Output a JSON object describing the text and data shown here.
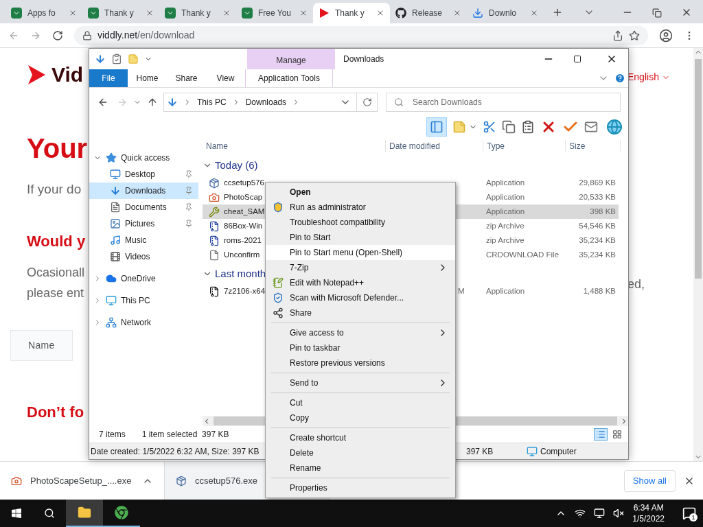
{
  "browser": {
    "tabs": [
      {
        "title": "Apps fo",
        "kind": "sheet",
        "selected": false
      },
      {
        "title": "Thank y",
        "kind": "sheet",
        "selected": false
      },
      {
        "title": "Thank y",
        "kind": "sheet",
        "selected": false
      },
      {
        "title": "Free You",
        "kind": "sheet",
        "selected": false
      },
      {
        "title": "Thank y",
        "kind": "video",
        "selected": true
      },
      {
        "title": "Release",
        "kind": "github",
        "selected": false
      },
      {
        "title": "Downlo",
        "kind": "download",
        "selected": false
      }
    ],
    "address": {
      "host": "viddly.net",
      "path": "/en/download"
    }
  },
  "page": {
    "logo": "Vid",
    "language": "English",
    "heading": "Your",
    "intro": "If your do",
    "subheading": "Would y",
    "para_lines": [
      "Ocasionall",
      "please ent"
    ],
    "para_right": "ed,",
    "name_field": "Name",
    "heading2": "Don’t fo"
  },
  "explorer": {
    "title": "Downloads",
    "context_tab": "Manage",
    "ribbon_tabs": [
      {
        "label": "File",
        "kind": "file"
      },
      {
        "label": "Home",
        "kind": "tab"
      },
      {
        "label": "Share",
        "kind": "tab"
      },
      {
        "label": "View",
        "kind": "tab"
      },
      {
        "label": "Application Tools",
        "kind": "context"
      }
    ],
    "breadcrumb": [
      "This PC",
      "Downloads"
    ],
    "search": {
      "placeholder": "Search Downloads"
    },
    "pane_toggle": {
      "on": true
    },
    "nav": [
      {
        "label": "Quick access",
        "kind": "star",
        "expanded": true,
        "selected": false,
        "children": [
          {
            "label": "Desktop",
            "kind": "desktop",
            "pinned": true,
            "selected": false
          },
          {
            "label": "Downloads",
            "kind": "download",
            "pinned": true,
            "selected": true
          },
          {
            "label": "Documents",
            "kind": "document",
            "pinned": true,
            "selected": false
          },
          {
            "label": "Pictures",
            "kind": "picture",
            "pinned": true,
            "selected": false
          },
          {
            "label": "Music",
            "kind": "music",
            "pinned": false,
            "selected": false
          },
          {
            "label": "Videos",
            "kind": "video",
            "pinned": false,
            "selected": false
          }
        ]
      },
      {
        "label": "OneDrive",
        "kind": "cloud",
        "expanded": false,
        "selected": false
      },
      {
        "label": "This PC",
        "kind": "pc",
        "expanded": false,
        "selected": false
      },
      {
        "label": "Network",
        "kind": "network",
        "expanded": false,
        "selected": false
      }
    ],
    "columns": [
      "Name",
      "Date modified",
      "Type",
      "Size"
    ],
    "groups": [
      {
        "label": "Today (6)",
        "expanded": true,
        "files": [
          {
            "name": "ccsetup576",
            "kind": "setup",
            "type": "Application",
            "size": "29,869 KB",
            "selected": false
          },
          {
            "name": "PhotoScap",
            "kind": "photoscape",
            "type": "Application",
            "size": "20,533 KB",
            "selected": false
          },
          {
            "name": "cheat_SAM",
            "kind": "cheat",
            "type": "Application",
            "size": "398 KB",
            "selected": true
          },
          {
            "name": "86Box-Win",
            "kind": "zip",
            "type": "zip Archive",
            "size": "54,546 KB",
            "selected": false
          },
          {
            "name": "roms-2021",
            "kind": "zip",
            "type": "zip Archive",
            "size": "35,234 KB",
            "selected": false
          },
          {
            "name": "Unconfirm",
            "kind": "blank",
            "type": "CRDOWNLOAD File",
            "size": "35,234 KB",
            "selected": false
          }
        ]
      },
      {
        "label": "Last month",
        "expanded": true,
        "files": [
          {
            "name": "7z2106-x64",
            "kind": "sevenzip",
            "date": "M",
            "type": "Application",
            "size": "1,488 KB",
            "selected": false
          }
        ]
      }
    ],
    "status": {
      "count": "7 items",
      "selection": "1 item selected",
      "selection_size": "397 KB"
    },
    "views": [
      {
        "kind": "details",
        "selected": true
      },
      {
        "kind": "tiles",
        "selected": false
      }
    ],
    "details": {
      "text": "Date created: 1/5/2022 6:32 AM, Size: 397 KB",
      "size": "397 KB",
      "location": "Computer"
    }
  },
  "context_menu": {
    "groups": [
      [
        {
          "label": "Open",
          "kind": "plain",
          "default": true,
          "submenu": false,
          "selected": false
        },
        {
          "label": "Run as administrator",
          "kind": "shield",
          "default": false,
          "submenu": false,
          "selected": false
        },
        {
          "label": "Troubleshoot compatibility",
          "kind": "plain",
          "default": false,
          "submenu": false,
          "selected": false
        },
        {
          "label": "Pin to Start",
          "kind": "plain",
          "default": false,
          "submenu": false,
          "selected": false
        },
        {
          "label": "Pin to Start menu (Open-Shell)",
          "kind": "plain",
          "default": false,
          "submenu": false,
          "selected": true
        },
        {
          "label": "7-Zip",
          "kind": "plain",
          "default": false,
          "submenu": true,
          "selected": false
        },
        {
          "label": "Edit with Notepad++",
          "kind": "notepad",
          "default": false,
          "submenu": false,
          "selected": false
        },
        {
          "label": "Scan with Microsoft Defender...",
          "kind": "defender",
          "default": false,
          "submenu": false,
          "selected": false
        },
        {
          "label": "Share",
          "kind": "share",
          "default": false,
          "submenu": false,
          "selected": false
        }
      ],
      [
        {
          "label": "Give access to",
          "kind": "plain",
          "default": false,
          "submenu": true,
          "selected": false
        },
        {
          "label": "Pin to taskbar",
          "kind": "plain",
          "default": false,
          "submenu": false,
          "selected": false
        },
        {
          "label": "Restore previous versions",
          "kind": "plain",
          "default": false,
          "submenu": false,
          "selected": false
        }
      ],
      [
        {
          "label": "Send to",
          "kind": "plain",
          "default": false,
          "submenu": true,
          "selected": false
        }
      ],
      [
        {
          "label": "Cut",
          "kind": "plain",
          "default": false,
          "submenu": false,
          "selected": false
        },
        {
          "label": "Copy",
          "kind": "plain",
          "default": false,
          "submenu": false,
          "selected": false
        }
      ],
      [
        {
          "label": "Create shortcut",
          "kind": "plain",
          "default": false,
          "submenu": false,
          "selected": false
        },
        {
          "label": "Delete",
          "kind": "plain",
          "default": false,
          "submenu": false,
          "selected": false
        },
        {
          "label": "Rename",
          "kind": "plain",
          "default": false,
          "submenu": false,
          "selected": false
        }
      ],
      [
        {
          "label": "Properties",
          "kind": "plain",
          "default": false,
          "submenu": false,
          "selected": false
        }
      ]
    ]
  },
  "downloads_bar": {
    "items": [
      {
        "name": "PhotoScapeSetup_....exe",
        "kind": "photoscape",
        "selected": false
      },
      {
        "name": "ccsetup576.exe",
        "kind": "setup",
        "selected": true
      }
    ],
    "show_all": "Show all"
  },
  "taskbar": {
    "apps": [
      {
        "kind": "explorer",
        "selected": true
      },
      {
        "kind": "chrome",
        "selected": false
      }
    ],
    "time": "6:34 AM",
    "date": "1/5/2022",
    "notifications": "1"
  }
}
